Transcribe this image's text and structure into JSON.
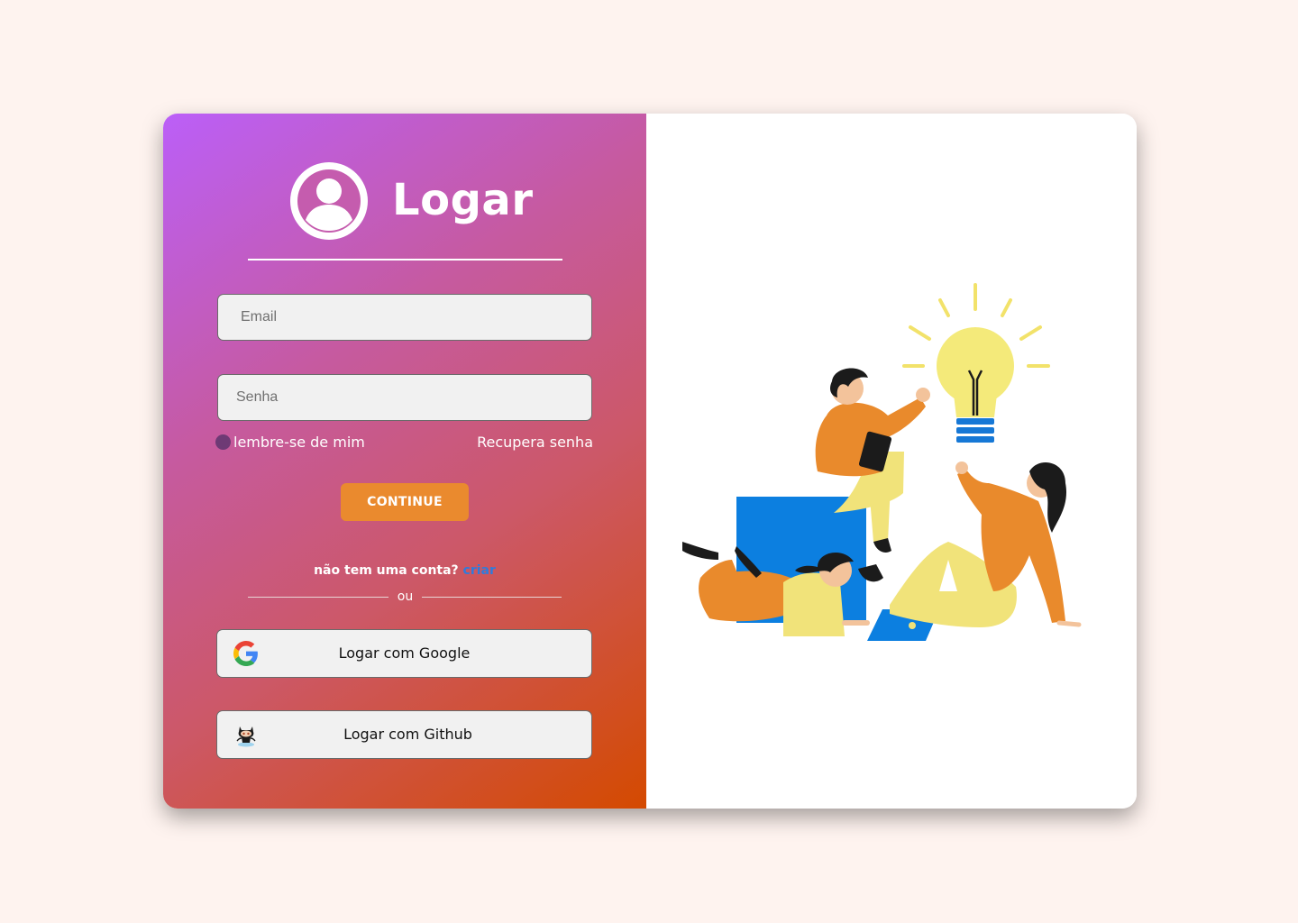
{
  "login": {
    "title": "Logar",
    "email_placeholder": "Email",
    "password_placeholder": "Senha",
    "remember_label": "lembre-se de mim",
    "recover_label": "Recupera senha",
    "continue_label": "CONTINUE",
    "no_account_text": "não tem uma conta? ",
    "create_link": "criar",
    "or_text": "ou",
    "google_label": "Logar com Google",
    "github_label": "Logar com Github"
  },
  "icons": {
    "avatar": "user-avatar-icon",
    "google": "google-icon",
    "github": "github-octocat-icon",
    "illustration": "team-idea-lightbulb-illustration"
  },
  "colors": {
    "page_background": "#fef3ef",
    "gradient_start": "#bb5ff8",
    "gradient_end": "#d44a00",
    "continue_button": "#ea8a2e",
    "create_link": "#2f7bdc",
    "field_background": "#f1f1f1"
  }
}
